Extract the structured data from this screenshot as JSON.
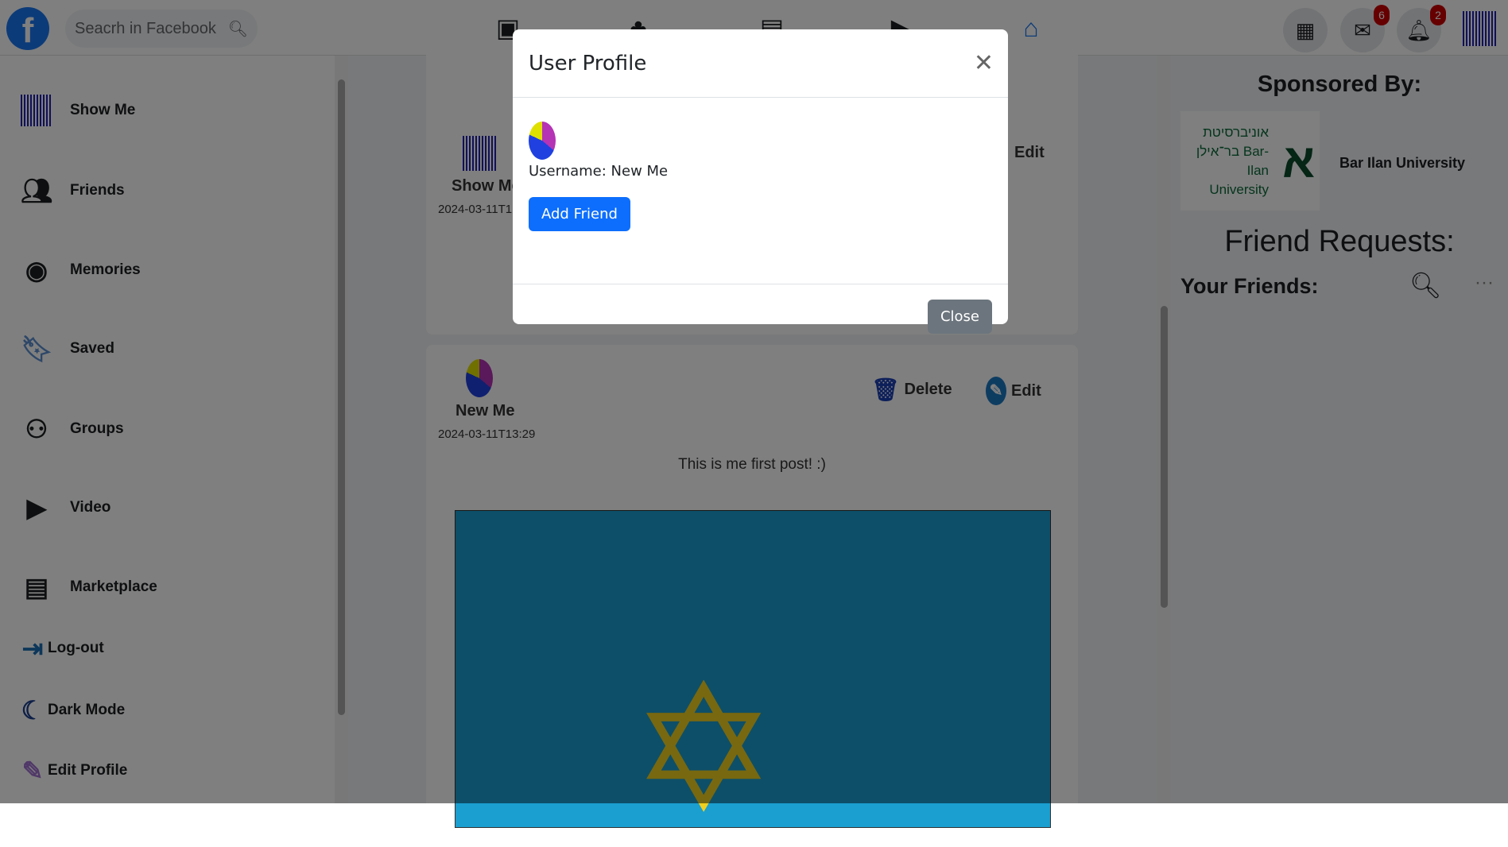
{
  "nav": {
    "search_placeholder": "Seacrh in Facebook",
    "messenger_count": "6",
    "notifications_count": "2"
  },
  "sidebar": {
    "items": [
      {
        "label": "Show Me",
        "icon": "profile-avatar"
      },
      {
        "label": "Friends",
        "icon": "friends-icon"
      },
      {
        "label": "Memories",
        "icon": "memories-icon"
      },
      {
        "label": "Saved",
        "icon": "bookmark-icon"
      },
      {
        "label": "Groups",
        "icon": "groups-icon"
      },
      {
        "label": "Video",
        "icon": "video-icon"
      },
      {
        "label": "Marketplace",
        "icon": "store-icon"
      },
      {
        "label": "Log-out",
        "icon": "logout-icon"
      },
      {
        "label": "Dark Mode",
        "icon": "moon-icon"
      },
      {
        "label": "Edit Profile",
        "icon": "pencil-icon"
      }
    ]
  },
  "posts": [
    {
      "author": "Show Me",
      "time": "2024-03-11T1",
      "edit": "Edit"
    },
    {
      "author": "New Me",
      "time": "2024-03-11T13:29",
      "delete": "Delete",
      "edit": "Edit",
      "text": "This is me first post! :)"
    }
  ],
  "right": {
    "sponsored": "Sponsored By:",
    "sponsor_name": "Bar Ilan University",
    "sponsor_logo_text": "אוניברסיטת בר־אילן Bar-Ilan University",
    "friend_requests": "Friend Requests:",
    "your_friends": "Your Friends:"
  },
  "modal": {
    "title": "User Profile",
    "username": "Username: New Me",
    "add_friend": "Add Friend",
    "close": "Close"
  },
  "colors": {
    "primary": "#0d6efd",
    "secondary": "#6c757d",
    "brand": "#1877f2"
  }
}
